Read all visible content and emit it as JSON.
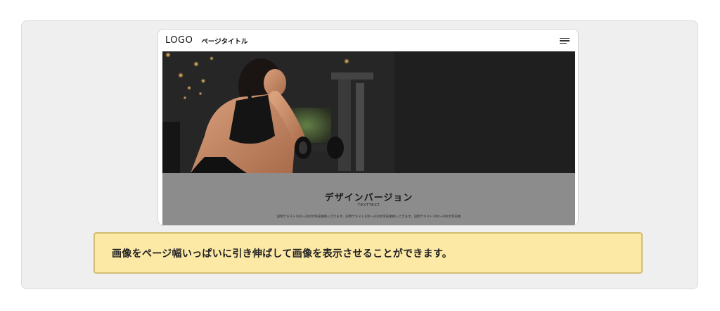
{
  "header": {
    "logo": "LOGO",
    "page_title": "ページタイトル",
    "menu_icon": "hamburger-menu-icon"
  },
  "hero": {
    "image_subject": "woman-lifting-dumbbell-photo"
  },
  "panel": {
    "title": "デザインバージョン",
    "subtitle": "TEXTTEXT",
    "description": "説明テキスト100〜200文字前後挿入できます。説明テキスト100〜200文字前後挿入できます。説明テキスト100〜200文字前後"
  },
  "note": {
    "text": "画像をページ幅いっぱいに引き伸ばして画像を表示させることができます。"
  },
  "colors": {
    "stage": "#efefef",
    "hero_bg": "#202020",
    "panel_bg": "#8c8c8c",
    "note_bg": "#fde9a6",
    "note_border": "#d2bd72"
  }
}
